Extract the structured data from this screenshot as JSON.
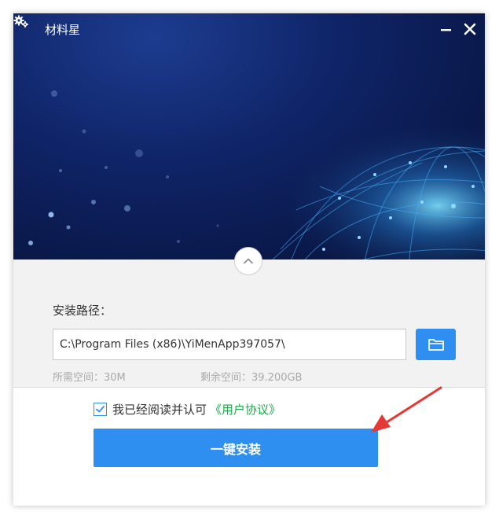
{
  "app": {
    "title": "材料星",
    "icon": "gears-icon"
  },
  "window_controls": {
    "minimize_icon": "minimize-icon",
    "close_icon": "close-icon"
  },
  "install": {
    "path_label": "安装路径：",
    "path_value": "C:\\Program Files (x86)\\YiMenApp397057\\",
    "browse_icon": "folder-icon",
    "required_space": "所需空间：30M",
    "free_space": "剩余空间：39.200GB",
    "collapse_icon": "chevron-up-icon"
  },
  "agreement": {
    "checked": true,
    "text": "我已经阅读并认可",
    "link_text": "《用户协议》"
  },
  "actions": {
    "install_button": "一键安装"
  },
  "colors": {
    "accent": "#2f8ff0",
    "link": "#1aac4b",
    "annotation_arrow": "#e53935"
  }
}
